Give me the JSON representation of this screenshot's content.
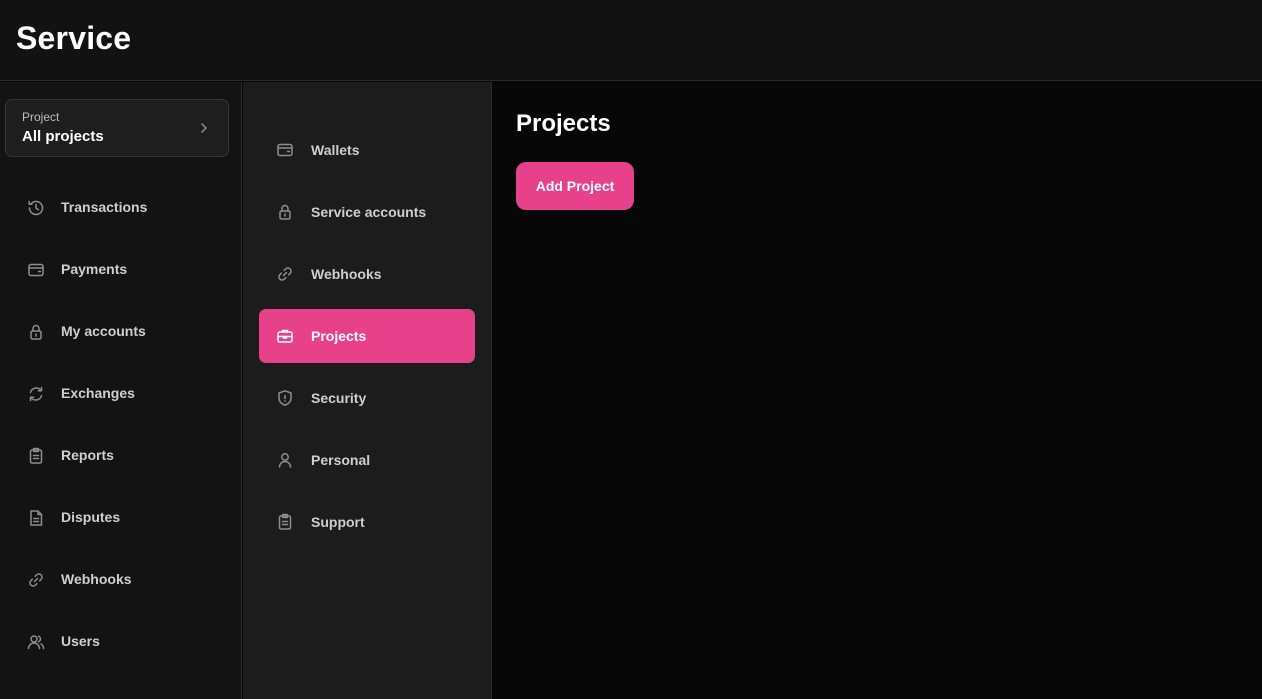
{
  "header": {
    "brand": "Service"
  },
  "sidebar": {
    "project_selector": {
      "label": "Project",
      "value": "All projects",
      "icon": "chevron-right-icon"
    },
    "items": [
      {
        "label": "Transactions",
        "icon": "history-icon"
      },
      {
        "label": "Payments",
        "icon": "wallet-icon"
      },
      {
        "label": "My accounts",
        "icon": "lock-icon"
      },
      {
        "label": "Exchanges",
        "icon": "exchange-icon"
      },
      {
        "label": "Reports",
        "icon": "clipboard-icon"
      },
      {
        "label": "Disputes",
        "icon": "document-icon"
      },
      {
        "label": "Webhooks",
        "icon": "link-icon"
      },
      {
        "label": "Users",
        "icon": "users-icon"
      }
    ]
  },
  "settings_nav": {
    "items": [
      {
        "label": "Wallets",
        "icon": "wallet-icon"
      },
      {
        "label": "Service accounts",
        "icon": "lock-icon"
      },
      {
        "label": "Webhooks",
        "icon": "link-icon"
      },
      {
        "label": "Projects",
        "icon": "briefcase-icon",
        "active": true
      },
      {
        "label": "Security",
        "icon": "shield-icon"
      },
      {
        "label": "Personal",
        "icon": "user-icon"
      },
      {
        "label": "Support",
        "icon": "clipboard-icon"
      }
    ]
  },
  "main": {
    "title": "Projects",
    "add_button_label": "Add Project"
  },
  "colors": {
    "accent": "#e8418c",
    "header_bg": "#121212",
    "sidebar_bg": "#131313",
    "subnav_bg": "#1c1c1c",
    "main_bg": "#070707"
  }
}
